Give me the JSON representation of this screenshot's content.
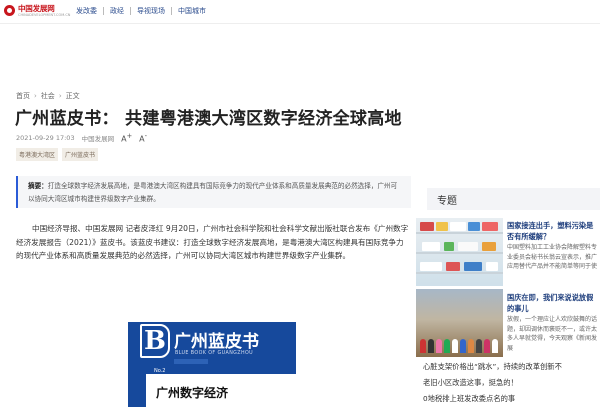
{
  "header": {
    "logo_text": "中国发展网",
    "logo_sub": "CHINADEVELOPMENT.COM.CN",
    "nav": [
      "发改委",
      "政经",
      "导视现场",
      "中国城市"
    ]
  },
  "breadcrumb": [
    "首页",
    "社会",
    "正文"
  ],
  "article": {
    "title": "广州蓝皮书：  共建粤港澳大湾区数字经济全球高地",
    "datetime": "2021-09-29 17:03",
    "source": "中国发展网",
    "font_large": "A",
    "font_small": "A",
    "tags": [
      "粤港澳大湾区",
      "广州蓝皮书"
    ],
    "abstract_label": "摘要：",
    "abstract_text": "打造全球数字经济发展高地，是粤港澳大湾区构建具有国际竞争力的现代产业体系和高质量发展典范的必然选择，广州可以协同大湾区城市构建世界级数字产业集群。",
    "body": "中国经济导报、中国发展网  记者皮泽红  9月20日，广州市社会科学院和社会科学文献出版社联合发布《广州数字经济发展报告（2021）》蓝皮书。该蓝皮书建议：打造全球数字经济发展高地，是粤港澳大湾区构建具有国际竞争力的现代产业体系和高质量发展典范的必然选择，广州可以协同大湾区城市构建世界级数字产业集群。"
  },
  "cover": {
    "letter": "B",
    "title": "广州蓝皮书",
    "english": "BLUE BOOK OF GUANGZHOU",
    "number": "No.2",
    "subtitle": "广州数字经济"
  },
  "sidebar": {
    "heading": "专题",
    "items": [
      {
        "title": "国家接连出手，塑料污染是否有所缓解？",
        "desc": "中国塑料加工工业协会降解塑料专业委员会秘书长翁云宣表示，推广应用替代产品并不能简单等同于使"
      },
      {
        "title": "国庆在即，我们来说说放假的事儿",
        "desc": "放假，一个理应让人欢欣鼓舞的话题，却因调休而褒贬不一，或许太多人早就觉得，今天观察《新闻发展"
      }
    ],
    "links": [
      "心脏支架价格出“跳水”，持续的改革创新不",
      "老旧小区改造这事，挺急的！",
      "0地税排上班发改委点名的事"
    ]
  },
  "colors": {
    "brand_red": "#c8161d",
    "link_blue": "#2a4b8d",
    "cover_blue": "#16499c",
    "abstract_accent": "#2a5bd7"
  }
}
